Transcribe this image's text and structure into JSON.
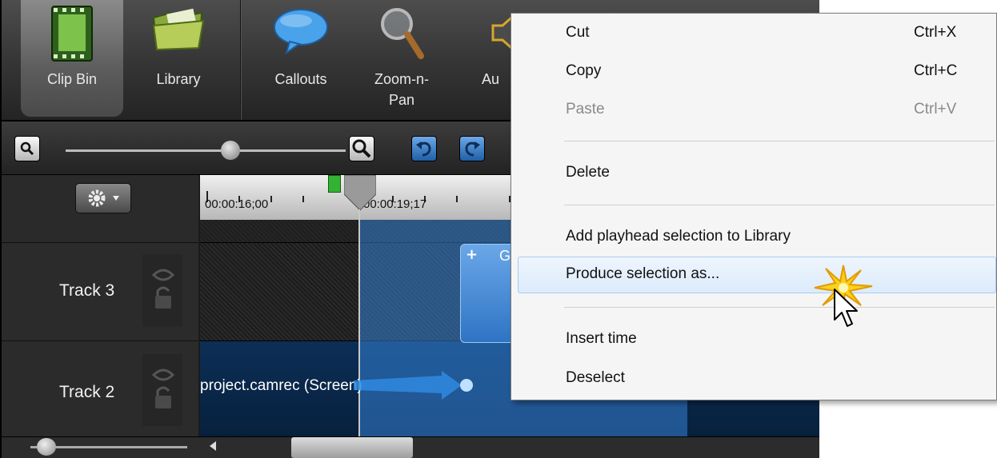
{
  "toolbar": {
    "tools": [
      {
        "label": "Clip Bin"
      },
      {
        "label": "Library"
      },
      {
        "label": "Callouts"
      },
      {
        "label": "Zoom-n-\nPan"
      },
      {
        "label": "Au"
      }
    ]
  },
  "timeline": {
    "timecodes": [
      "00:00:16;00",
      "00:00:19;17"
    ],
    "tracks": [
      {
        "name": "Track 3"
      },
      {
        "name": "Track 2"
      }
    ],
    "callout_label": "G",
    "clip_label": "project.camrec (Screen)"
  },
  "context_menu": {
    "items": [
      {
        "label": "Cut",
        "shortcut": "Ctrl+X",
        "enabled": true
      },
      {
        "label": "Copy",
        "shortcut": "Ctrl+C",
        "enabled": true
      },
      {
        "label": "Paste",
        "shortcut": "Ctrl+V",
        "enabled": false
      },
      {
        "label": "Delete",
        "shortcut": "",
        "enabled": true
      },
      {
        "label": "Add playhead selection to Library",
        "shortcut": "",
        "enabled": true
      },
      {
        "label": "Produce selection as...",
        "shortcut": "",
        "enabled": true,
        "highlighted": true
      },
      {
        "label": "Insert time",
        "shortcut": "",
        "enabled": true
      },
      {
        "label": "Deselect",
        "shortcut": "",
        "enabled": true
      }
    ]
  },
  "colors": {
    "selection": "#3482d6",
    "toolbar_bg": "#363636",
    "menu_bg": "#f5f5f5",
    "menu_highlight": "#dcebfc"
  }
}
